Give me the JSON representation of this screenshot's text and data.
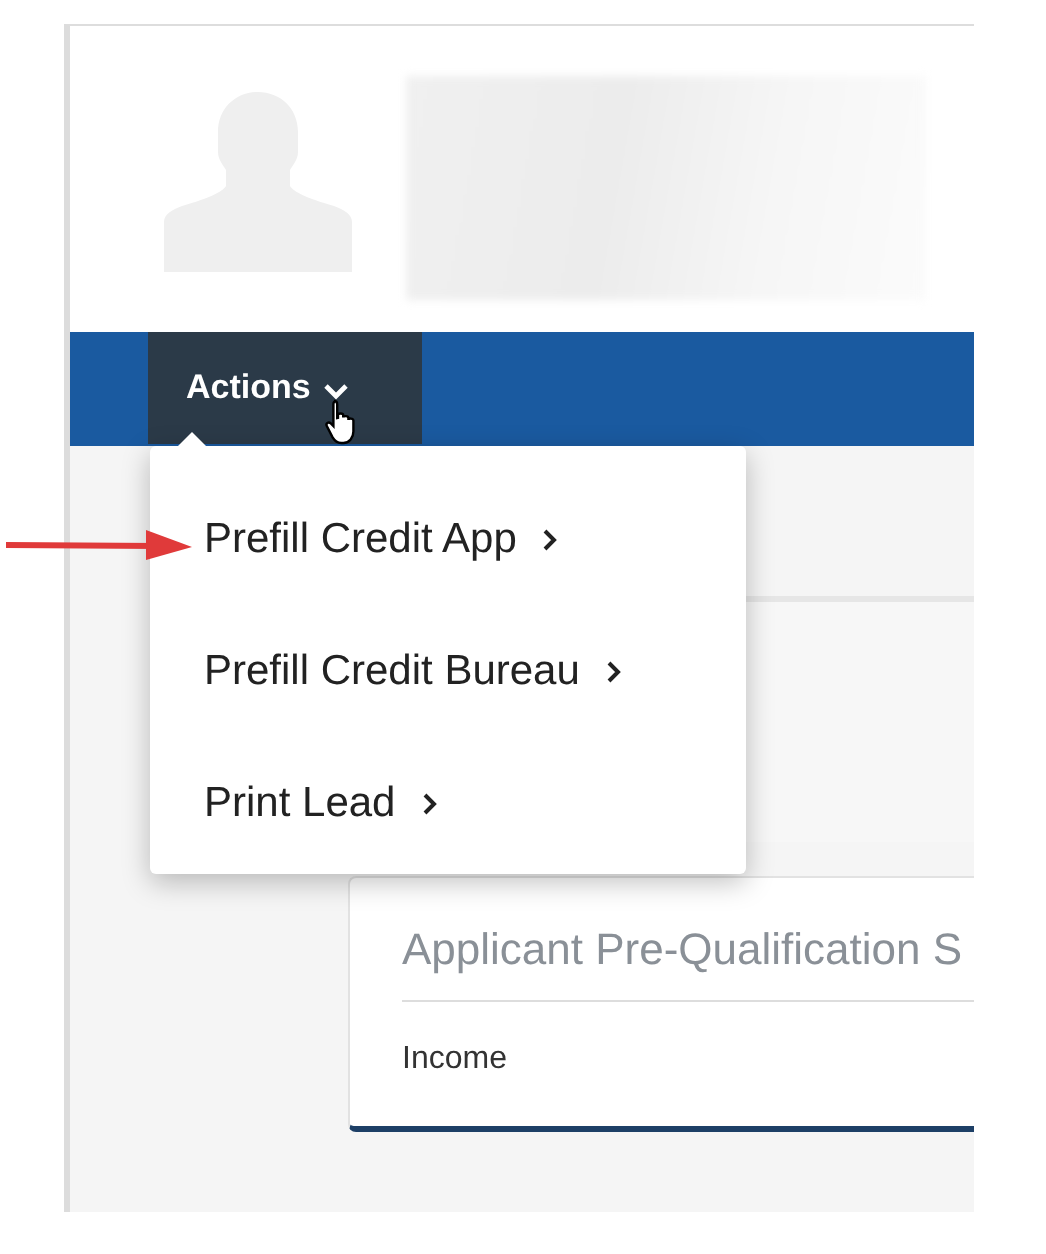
{
  "toolbar": {
    "actions_button": "Actions"
  },
  "actions_menu": {
    "items": [
      {
        "label": "Prefill Credit App"
      },
      {
        "label": "Prefill Credit Bureau"
      },
      {
        "label": "Print Lead"
      }
    ]
  },
  "card": {
    "title": "Applicant Pre-Qualification S",
    "field_label": "Income"
  }
}
